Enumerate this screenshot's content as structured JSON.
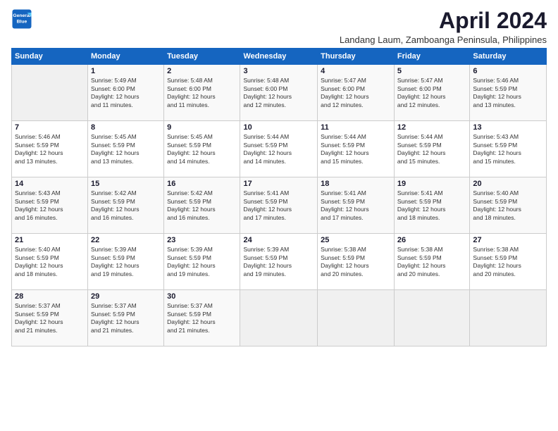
{
  "logo": {
    "line1": "General",
    "line2": "Blue"
  },
  "title": "April 2024",
  "location": "Landang Laum, Zamboanga Peninsula, Philippines",
  "weekdays": [
    "Sunday",
    "Monday",
    "Tuesday",
    "Wednesday",
    "Thursday",
    "Friday",
    "Saturday"
  ],
  "weeks": [
    [
      {
        "day": "",
        "info": ""
      },
      {
        "day": "1",
        "info": "Sunrise: 5:49 AM\nSunset: 6:00 PM\nDaylight: 12 hours\nand 11 minutes."
      },
      {
        "day": "2",
        "info": "Sunrise: 5:48 AM\nSunset: 6:00 PM\nDaylight: 12 hours\nand 11 minutes."
      },
      {
        "day": "3",
        "info": "Sunrise: 5:48 AM\nSunset: 6:00 PM\nDaylight: 12 hours\nand 12 minutes."
      },
      {
        "day": "4",
        "info": "Sunrise: 5:47 AM\nSunset: 6:00 PM\nDaylight: 12 hours\nand 12 minutes."
      },
      {
        "day": "5",
        "info": "Sunrise: 5:47 AM\nSunset: 6:00 PM\nDaylight: 12 hours\nand 12 minutes."
      },
      {
        "day": "6",
        "info": "Sunrise: 5:46 AM\nSunset: 5:59 PM\nDaylight: 12 hours\nand 13 minutes."
      }
    ],
    [
      {
        "day": "7",
        "info": "Sunrise: 5:46 AM\nSunset: 5:59 PM\nDaylight: 12 hours\nand 13 minutes."
      },
      {
        "day": "8",
        "info": "Sunrise: 5:45 AM\nSunset: 5:59 PM\nDaylight: 12 hours\nand 13 minutes."
      },
      {
        "day": "9",
        "info": "Sunrise: 5:45 AM\nSunset: 5:59 PM\nDaylight: 12 hours\nand 14 minutes."
      },
      {
        "day": "10",
        "info": "Sunrise: 5:44 AM\nSunset: 5:59 PM\nDaylight: 12 hours\nand 14 minutes."
      },
      {
        "day": "11",
        "info": "Sunrise: 5:44 AM\nSunset: 5:59 PM\nDaylight: 12 hours\nand 15 minutes."
      },
      {
        "day": "12",
        "info": "Sunrise: 5:44 AM\nSunset: 5:59 PM\nDaylight: 12 hours\nand 15 minutes."
      },
      {
        "day": "13",
        "info": "Sunrise: 5:43 AM\nSunset: 5:59 PM\nDaylight: 12 hours\nand 15 minutes."
      }
    ],
    [
      {
        "day": "14",
        "info": "Sunrise: 5:43 AM\nSunset: 5:59 PM\nDaylight: 12 hours\nand 16 minutes."
      },
      {
        "day": "15",
        "info": "Sunrise: 5:42 AM\nSunset: 5:59 PM\nDaylight: 12 hours\nand 16 minutes."
      },
      {
        "day": "16",
        "info": "Sunrise: 5:42 AM\nSunset: 5:59 PM\nDaylight: 12 hours\nand 16 minutes."
      },
      {
        "day": "17",
        "info": "Sunrise: 5:41 AM\nSunset: 5:59 PM\nDaylight: 12 hours\nand 17 minutes."
      },
      {
        "day": "18",
        "info": "Sunrise: 5:41 AM\nSunset: 5:59 PM\nDaylight: 12 hours\nand 17 minutes."
      },
      {
        "day": "19",
        "info": "Sunrise: 5:41 AM\nSunset: 5:59 PM\nDaylight: 12 hours\nand 18 minutes."
      },
      {
        "day": "20",
        "info": "Sunrise: 5:40 AM\nSunset: 5:59 PM\nDaylight: 12 hours\nand 18 minutes."
      }
    ],
    [
      {
        "day": "21",
        "info": "Sunrise: 5:40 AM\nSunset: 5:59 PM\nDaylight: 12 hours\nand 18 minutes."
      },
      {
        "day": "22",
        "info": "Sunrise: 5:39 AM\nSunset: 5:59 PM\nDaylight: 12 hours\nand 19 minutes."
      },
      {
        "day": "23",
        "info": "Sunrise: 5:39 AM\nSunset: 5:59 PM\nDaylight: 12 hours\nand 19 minutes."
      },
      {
        "day": "24",
        "info": "Sunrise: 5:39 AM\nSunset: 5:59 PM\nDaylight: 12 hours\nand 19 minutes."
      },
      {
        "day": "25",
        "info": "Sunrise: 5:38 AM\nSunset: 5:59 PM\nDaylight: 12 hours\nand 20 minutes."
      },
      {
        "day": "26",
        "info": "Sunrise: 5:38 AM\nSunset: 5:59 PM\nDaylight: 12 hours\nand 20 minutes."
      },
      {
        "day": "27",
        "info": "Sunrise: 5:38 AM\nSunset: 5:59 PM\nDaylight: 12 hours\nand 20 minutes."
      }
    ],
    [
      {
        "day": "28",
        "info": "Sunrise: 5:37 AM\nSunset: 5:59 PM\nDaylight: 12 hours\nand 21 minutes."
      },
      {
        "day": "29",
        "info": "Sunrise: 5:37 AM\nSunset: 5:59 PM\nDaylight: 12 hours\nand 21 minutes."
      },
      {
        "day": "30",
        "info": "Sunrise: 5:37 AM\nSunset: 5:59 PM\nDaylight: 12 hours\nand 21 minutes."
      },
      {
        "day": "",
        "info": ""
      },
      {
        "day": "",
        "info": ""
      },
      {
        "day": "",
        "info": ""
      },
      {
        "day": "",
        "info": ""
      }
    ]
  ]
}
